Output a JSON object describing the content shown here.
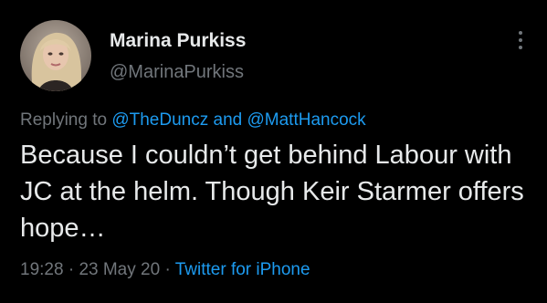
{
  "author": {
    "display_name": "Marina Purkiss",
    "handle": "@MarinaPurkiss",
    "avatar_icon": "profile-photo"
  },
  "more_icon": "vertical-ellipsis-icon",
  "reply": {
    "prefix": "Replying to",
    "mention_1": "@TheDuncz",
    "conjunction": "and",
    "mention_2": "@MattHancock"
  },
  "tweet": {
    "text": "Because I couldn’t get behind Labour with JC at the helm. Though Keir Starmer offers hope…"
  },
  "meta": {
    "time": "19:28",
    "separator_1": "·",
    "date": "23 May 20",
    "separator_2": "·",
    "source": "Twitter for iPhone"
  },
  "colors": {
    "background": "#000000",
    "text": "#e7e9ea",
    "muted": "#71767b",
    "link": "#1d9bf0"
  }
}
